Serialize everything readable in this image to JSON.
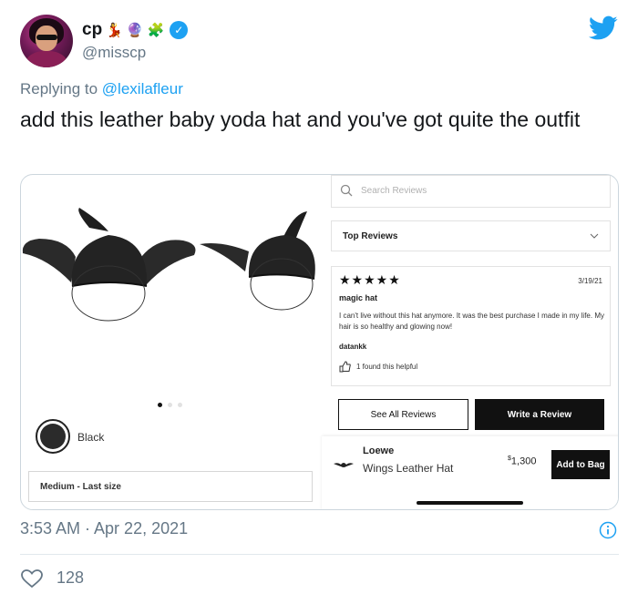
{
  "user": {
    "display_name": "cp",
    "emojis": [
      "💃",
      "🔮",
      "🧩"
    ],
    "handle": "@misscp",
    "verified": true
  },
  "reply": {
    "prefix": "Replying to",
    "mention": "@lexilafleur"
  },
  "tweet_text": "add this leather baby yoda hat and you've got quite the outfit",
  "media": {
    "color_label": "Black",
    "size_label": "Medium - Last size",
    "carousel": {
      "count": 3,
      "active": 1
    },
    "search_placeholder": "Search Reviews",
    "sort_label": "Top Reviews",
    "review": {
      "stars": "★★★★★",
      "date": "3/19/21",
      "title": "magic hat",
      "body": "I can't live without this hat anymore. It was the best purchase I made in my life. My hair is so healthy and glowing now!",
      "author": "datankk",
      "helpful": "1 found this helpful"
    },
    "see_all_label": "See All Reviews",
    "write_review_label": "Write a Review",
    "brand": "Loewe",
    "product_name": "Wings Leather Hat",
    "price_symbol": "$",
    "price_value": "1,300",
    "add_to_bag_label": "Add to Bag"
  },
  "timestamp": "3:53 AM · Apr 22, 2021",
  "likes": "128",
  "colors": {
    "twitter_blue": "#1da1f2",
    "secondary_text": "#657786",
    "border": "#ccd6dd"
  }
}
